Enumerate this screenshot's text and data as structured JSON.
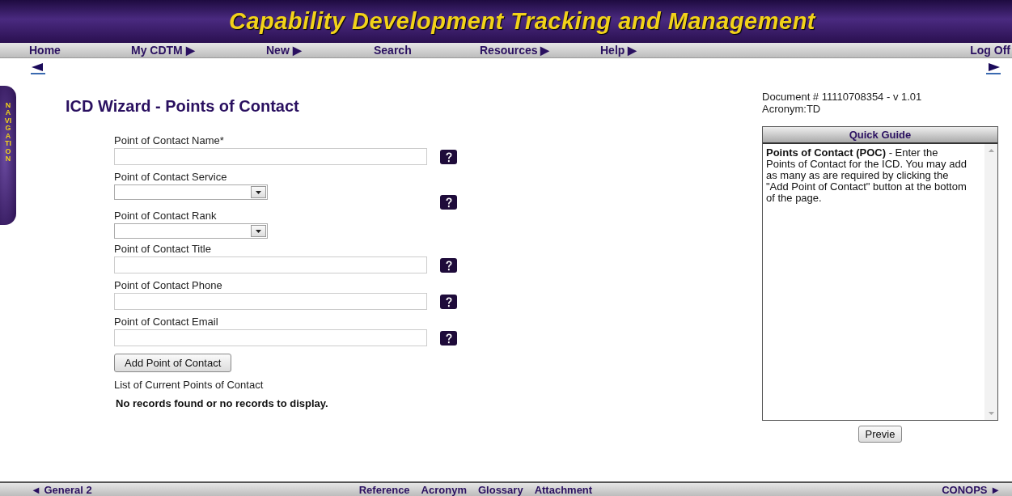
{
  "banner": {
    "title": "Capability Development Tracking and Management"
  },
  "menu": [
    {
      "label": "Home"
    },
    {
      "label": "My CDTM ▶"
    },
    {
      "label": "New ▶"
    },
    {
      "label": "Search"
    },
    {
      "label": "Resources ▶"
    },
    {
      "label": "Help ▶"
    },
    {
      "label": "Log Off"
    }
  ],
  "navigation_tab": {
    "label": "NAVIGATION"
  },
  "page_title": "ICD Wizard - Points of Contact",
  "fields": [
    {
      "label": "Point of Contact Name*",
      "kind": "text",
      "help": true
    },
    {
      "label": "Point of Contact Service",
      "kind": "select",
      "help": true
    },
    {
      "label": "Point of Contact Rank",
      "kind": "select",
      "help": false
    },
    {
      "label": "Point of Contact Title",
      "kind": "text",
      "help": true
    },
    {
      "label": "Point of Contact Phone",
      "kind": "text",
      "help": true
    },
    {
      "label": "Point of Contact Email",
      "kind": "text",
      "help": true
    }
  ],
  "add_button": "Add Point of Contact",
  "list_heading": "List of Current Points of Contact",
  "empty_message": "No records found or no records to display.",
  "document": {
    "number": "Document # 11110708354 - v 1.01",
    "acronym": "Acronym:TD"
  },
  "quick_guide": {
    "title": "Quick Guide",
    "text": "**Points of Contact (POC)** - Enter the Points of Contact for the ICD. You may add as many as are required by clicking the \"Add Point of Contact\" button at the bottom of the page."
  },
  "preview_button": "Previe",
  "footer": {
    "previous": "◄ General 2",
    "links": [
      "Reference",
      "Acronym",
      "Glossary",
      "Attachment"
    ],
    "next": "CONOPS ►"
  }
}
